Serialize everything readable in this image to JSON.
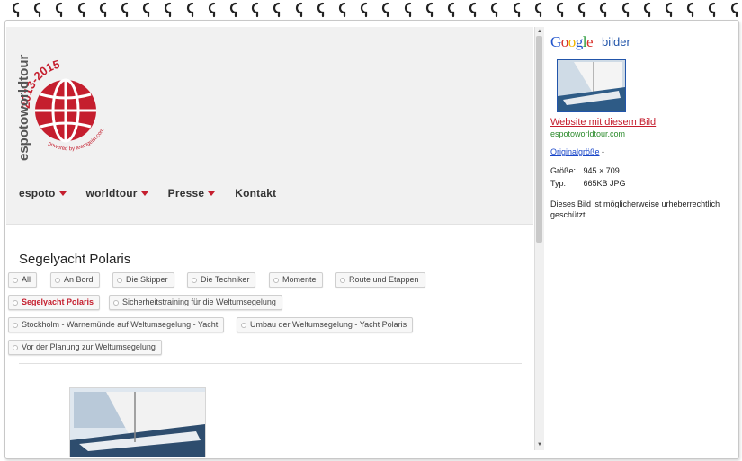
{
  "logo": {
    "years": "2013-2015",
    "name": "espotoworldtour",
    "powered": "powered by teamgeist.com",
    "brand_color": "#c51e2e"
  },
  "nav": {
    "items": [
      {
        "label": "espoto",
        "has_dropdown": true
      },
      {
        "label": "worldtour",
        "has_dropdown": true
      },
      {
        "label": "Presse",
        "has_dropdown": true
      },
      {
        "label": "Kontakt",
        "has_dropdown": false
      }
    ]
  },
  "page": {
    "heading": "Segelyacht Polaris"
  },
  "tags": [
    {
      "label": "All",
      "active": false
    },
    {
      "label": "An Bord",
      "active": false
    },
    {
      "label": "Die Skipper",
      "active": false
    },
    {
      "label": "Die Techniker",
      "active": false
    },
    {
      "label": "Momente",
      "active": false
    },
    {
      "label": "Route und Etappen",
      "active": false
    },
    {
      "label": "Segelyacht Polaris",
      "active": true
    },
    {
      "label": "Sicherheitstraining für die Weltumsegelung",
      "active": false
    },
    {
      "label": "Stockholm - Warnemünde auf Weltumsegelung - Yacht",
      "active": false
    },
    {
      "label": "Umbau der Weltumsegelung - Yacht Polaris",
      "active": false
    },
    {
      "label": "Vor der Planung zur Weltumsegelung",
      "active": false
    }
  ],
  "google": {
    "brand": "Google",
    "section": "bilder",
    "website_link": "Website mit diesem Bild",
    "site": "espotoworldtour.com",
    "original_link": "Originalgröße",
    "original_suffix": " -",
    "size_label": "Größe:",
    "size_value": "945 × 709",
    "type_label": "Typ:",
    "type_value": "665KB JPG",
    "note": "Dieses Bild ist möglicherweise urheberrechtlich geschützt."
  },
  "colors": {
    "accent_red": "#c51e2e",
    "link_blue": "#1a47c9",
    "site_green": "#2a8a2a"
  }
}
